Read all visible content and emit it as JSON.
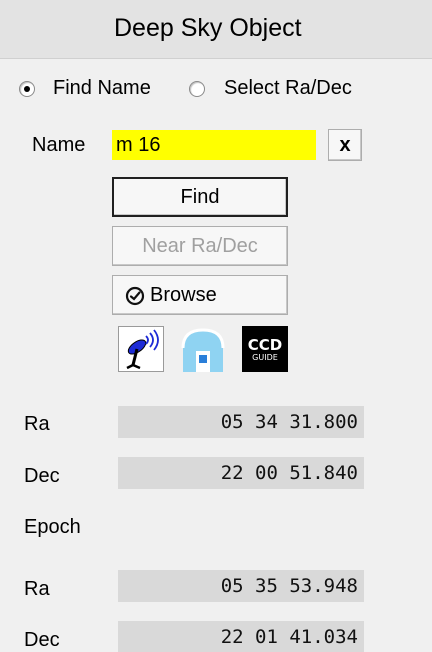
{
  "panel": {
    "title": "Deep Sky Object"
  },
  "mode": {
    "find_name_label": "Find Name",
    "select_radec_label": "Select Ra/Dec",
    "selected": "find_name"
  },
  "search": {
    "name_label": "Name",
    "name_value": "m 16",
    "clear_label": "x"
  },
  "buttons": {
    "find_label": "Find",
    "near_label": "Near Ra/Dec",
    "browse_label": "Browse"
  },
  "icons": [
    {
      "name": "telescope-antenna-icon"
    },
    {
      "name": "observatory-dome-icon"
    },
    {
      "name": "ccd-guide-icon",
      "text_top": "CCD",
      "text_bottom": "GUIDE"
    }
  ],
  "coords": {
    "ra_label": "Ra",
    "ra_value": "05 34 31.800",
    "dec_label": "Dec",
    "dec_value": "22 00 51.840",
    "epoch_label": "Epoch",
    "epoch_ra_label": "Ra",
    "epoch_ra_value": "05 35 53.948",
    "epoch_dec_label": "Dec",
    "epoch_dec_value": "22 01 41.034"
  },
  "colors": {
    "name_highlight": "#ffff00",
    "panel_bg": "#f0f0f0",
    "value_box_bg": "#d9d9d9"
  }
}
